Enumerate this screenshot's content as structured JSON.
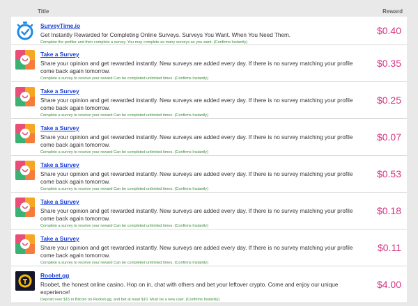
{
  "header": {
    "title": "Title",
    "reward": "Reward"
  },
  "colors": {
    "reward": "#d63384",
    "title_link": "#1a3fd6",
    "note": "#3a8a3a"
  },
  "rows": [
    {
      "title": "SurveyTime.io",
      "description": "Get Instantly Rewarded for Completing Online Surveys. Surveys You Want. When You Need Them.",
      "note": "Complete the profiler and then complete a survey. You may complete as many surveys as you want. (Confirms Instantly)",
      "reward": "$0.40",
      "icon": "stopwatch-icon"
    },
    {
      "title": "Take a Survey",
      "description": "Share your opinion and get rewarded instantly. New surveys are added every day. If there is no survey matching your profile come back again tomorrow.",
      "note": "Complete a survey to receive your reward Can be completed unlimited times. (Confirms Instantly)",
      "reward": "$0.35",
      "icon": "survey-app-icon"
    },
    {
      "title": "Take a Survey",
      "description": "Share your opinion and get rewarded instantly. New surveys are added every day. If there is no survey matching your profile come back again tomorrow.",
      "note": "Complete a survey to receive your reward Can be completed unlimited times. (Confirms Instantly)",
      "reward": "$0.25",
      "icon": "survey-app-icon"
    },
    {
      "title": "Take a Survey",
      "description": "Share your opinion and get rewarded instantly. New surveys are added every day. If there is no survey matching your profile come back again tomorrow.",
      "note": "Complete a survey to receive your reward Can be completed unlimited times. (Confirms Instantly)",
      "reward": "$0.07",
      "icon": "survey-app-icon"
    },
    {
      "title": "Take a Survey",
      "description": "Share your opinion and get rewarded instantly. New surveys are added every day. If there is no survey matching your profile come back again tomorrow.",
      "note": "Complete a survey to receive your reward Can be completed unlimited times. (Confirms Instantly)",
      "reward": "$0.53",
      "icon": "survey-app-icon"
    },
    {
      "title": "Take a Survey",
      "description": "Share your opinion and get rewarded instantly. New surveys are added every day. If there is no survey matching your profile come back again tomorrow.",
      "note": "Complete a survey to receive your reward Can be completed unlimited times. (Confirms Instantly)",
      "reward": "$0.18",
      "icon": "survey-app-icon"
    },
    {
      "title": "Take a Survey",
      "description": "Share your opinion and get rewarded instantly. New surveys are added every day. If there is no survey matching your profile come back again tomorrow.",
      "note": "Complete a survey to receive your reward Can be completed unlimited times. (Confirms Instantly)",
      "reward": "$0.11",
      "icon": "survey-app-icon"
    },
    {
      "title": "Roobet.gg",
      "description": "Roobet, the honest online casino. Hop on in, chat with others and bet your leftover crypto. Come and enjoy our unique experience!",
      "note": "Deposit over $15 in Bitcoin on Roobet.gg, and bet at least $10. Must be a new user. (Confirms Instantly)",
      "reward": "$4.00",
      "icon": "roobet-logo-icon"
    }
  ]
}
